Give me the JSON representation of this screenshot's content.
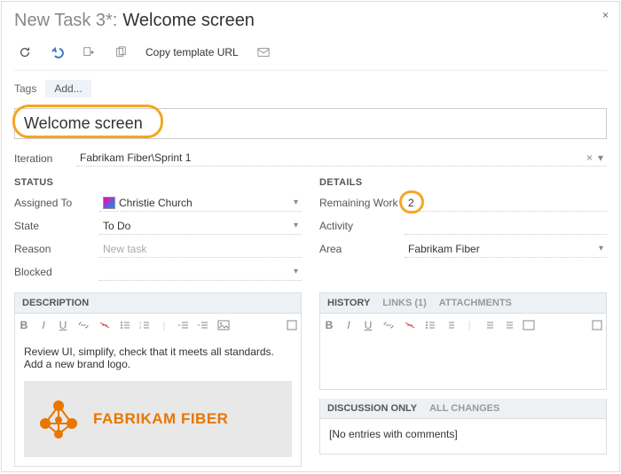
{
  "header": {
    "prefix": "New Task 3*:",
    "title": "Welcome screen",
    "close": "×"
  },
  "toolbar": {
    "copy_url": "Copy template URL"
  },
  "tags": {
    "label": "Tags",
    "add": "Add..."
  },
  "title_input": "Welcome screen",
  "iteration": {
    "label": "Iteration",
    "value": "Fabrikam Fiber\\Sprint 1"
  },
  "status": {
    "head": "STATUS",
    "assigned_to": {
      "label": "Assigned To",
      "value": "Christie Church"
    },
    "state": {
      "label": "State",
      "value": "To Do"
    },
    "reason": {
      "label": "Reason",
      "value": "New task"
    },
    "blocked": {
      "label": "Blocked",
      "value": ""
    }
  },
  "details": {
    "head": "DETAILS",
    "remaining_work": {
      "label": "Remaining Work",
      "value": "2"
    },
    "activity": {
      "label": "Activity",
      "value": ""
    },
    "area": {
      "label": "Area",
      "value": "Fabrikam Fiber"
    }
  },
  "description": {
    "head": "DESCRIPTION",
    "body": "Review UI, simplify, check that it meets all standards. Add a new brand logo.",
    "brand": "FABRIKAM FIBER"
  },
  "history": {
    "tabs": {
      "history": "HISTORY",
      "links": "LINKS (1)",
      "attachments": "ATTACHMENTS"
    },
    "disc_tabs": {
      "discussion": "DISCUSSION ONLY",
      "all": "ALL CHANGES"
    },
    "empty": "[No entries with comments]"
  },
  "icons": {
    "bold": "B",
    "italic": "I",
    "underline": "U"
  }
}
